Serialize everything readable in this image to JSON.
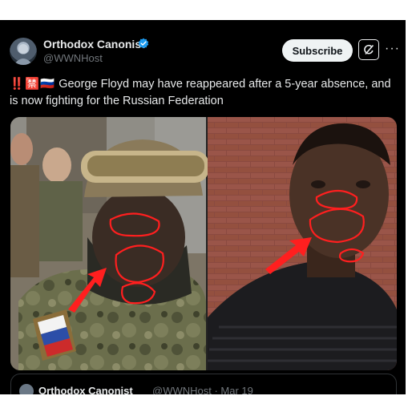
{
  "post": {
    "display_name": "Orthodox Canonist",
    "handle": "@WWNHost",
    "verified": true,
    "flags": "‼️🈲🇷🇺",
    "text": "George Floyd may have reappeared after a 5-year absence, and is now fighting for the Russian Federation"
  },
  "actions": {
    "subscribe_label": "Subscribe",
    "grok_icon": "grok-icon",
    "more_icon": "more-icon"
  },
  "quoted_post": {
    "display_name": "Orthodox Canonist",
    "meta": "@WWNHost · Mar 19"
  },
  "colors": {
    "background": "#000000",
    "text_primary": "#e7e9ea",
    "text_secondary": "#71767b",
    "verified_blue": "#1d9bf0",
    "annotation_red": "#ff1f1f"
  }
}
